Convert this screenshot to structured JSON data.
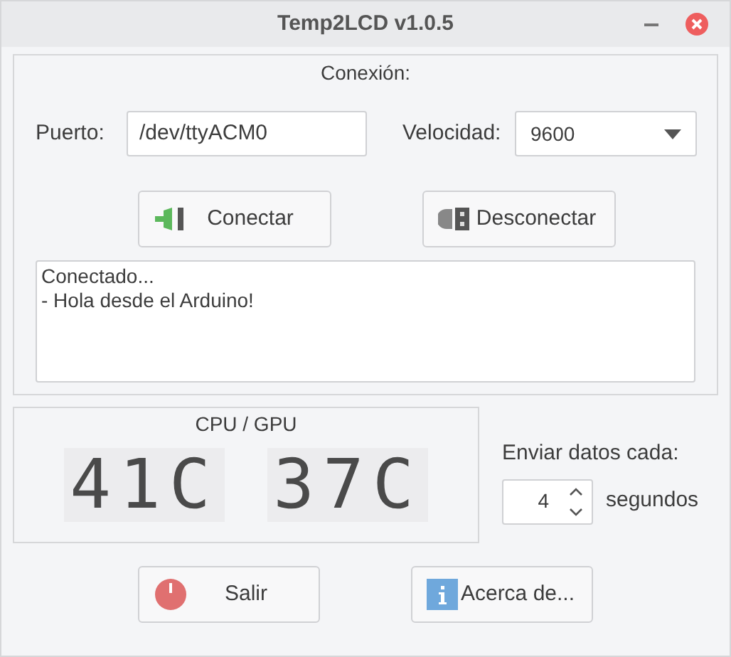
{
  "window": {
    "title": "Temp2LCD v1.0.5"
  },
  "connection": {
    "title": "Conexión:",
    "port": {
      "label": "Puerto:",
      "value": "/dev/ttyACM0"
    },
    "speed": {
      "label": "Velocidad:",
      "value": "9600"
    },
    "buttons": [
      {
        "label": "Conectar",
        "kind": "connect"
      },
      {
        "label": "Desconectar",
        "kind": "disconnect"
      }
    ],
    "log": [
      "Conectado...",
      "- Hola desde el Arduino!"
    ]
  },
  "display": {
    "title": "CPU / GPU",
    "readings": [
      "41C",
      "37C"
    ]
  },
  "interval": {
    "label": "Enviar datos cada:",
    "value": "4",
    "unit": "segundos"
  },
  "buttons": [
    {
      "label": "Salir",
      "kind": "exit"
    },
    {
      "label": "Acerca de...",
      "kind": "about"
    }
  ]
}
